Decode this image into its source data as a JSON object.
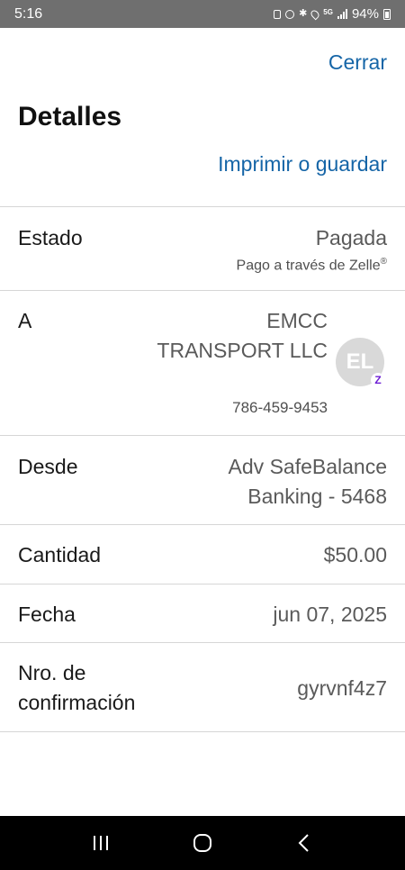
{
  "status_bar": {
    "time": "5:16",
    "battery": "94%"
  },
  "header": {
    "close_label": "Cerrar",
    "title": "Detalles",
    "print_label": "Imprimir o guardar"
  },
  "details": {
    "status": {
      "label": "Estado",
      "value": "Pagada",
      "sub": "Pago a través de Zelle",
      "sub_mark": "®"
    },
    "to": {
      "label": "A",
      "name": "EMCC TRANSPORT LLC",
      "phone": "786-459-9453",
      "avatar_initials": "EL",
      "badge": "Z"
    },
    "from": {
      "label": "Desde",
      "value": "Adv SafeBalance Banking - 5468"
    },
    "amount": {
      "label": "Cantidad",
      "value": "$50.00"
    },
    "date": {
      "label": "Fecha",
      "value": "jun 07, 2025"
    },
    "confirmation": {
      "label": "Nro. de confirmación",
      "value": "gyrvnf4z7"
    }
  },
  "colors": {
    "link": "#1565a7",
    "status_bar": "#6f6f6f",
    "zelle_purple": "#6d1ed4"
  }
}
